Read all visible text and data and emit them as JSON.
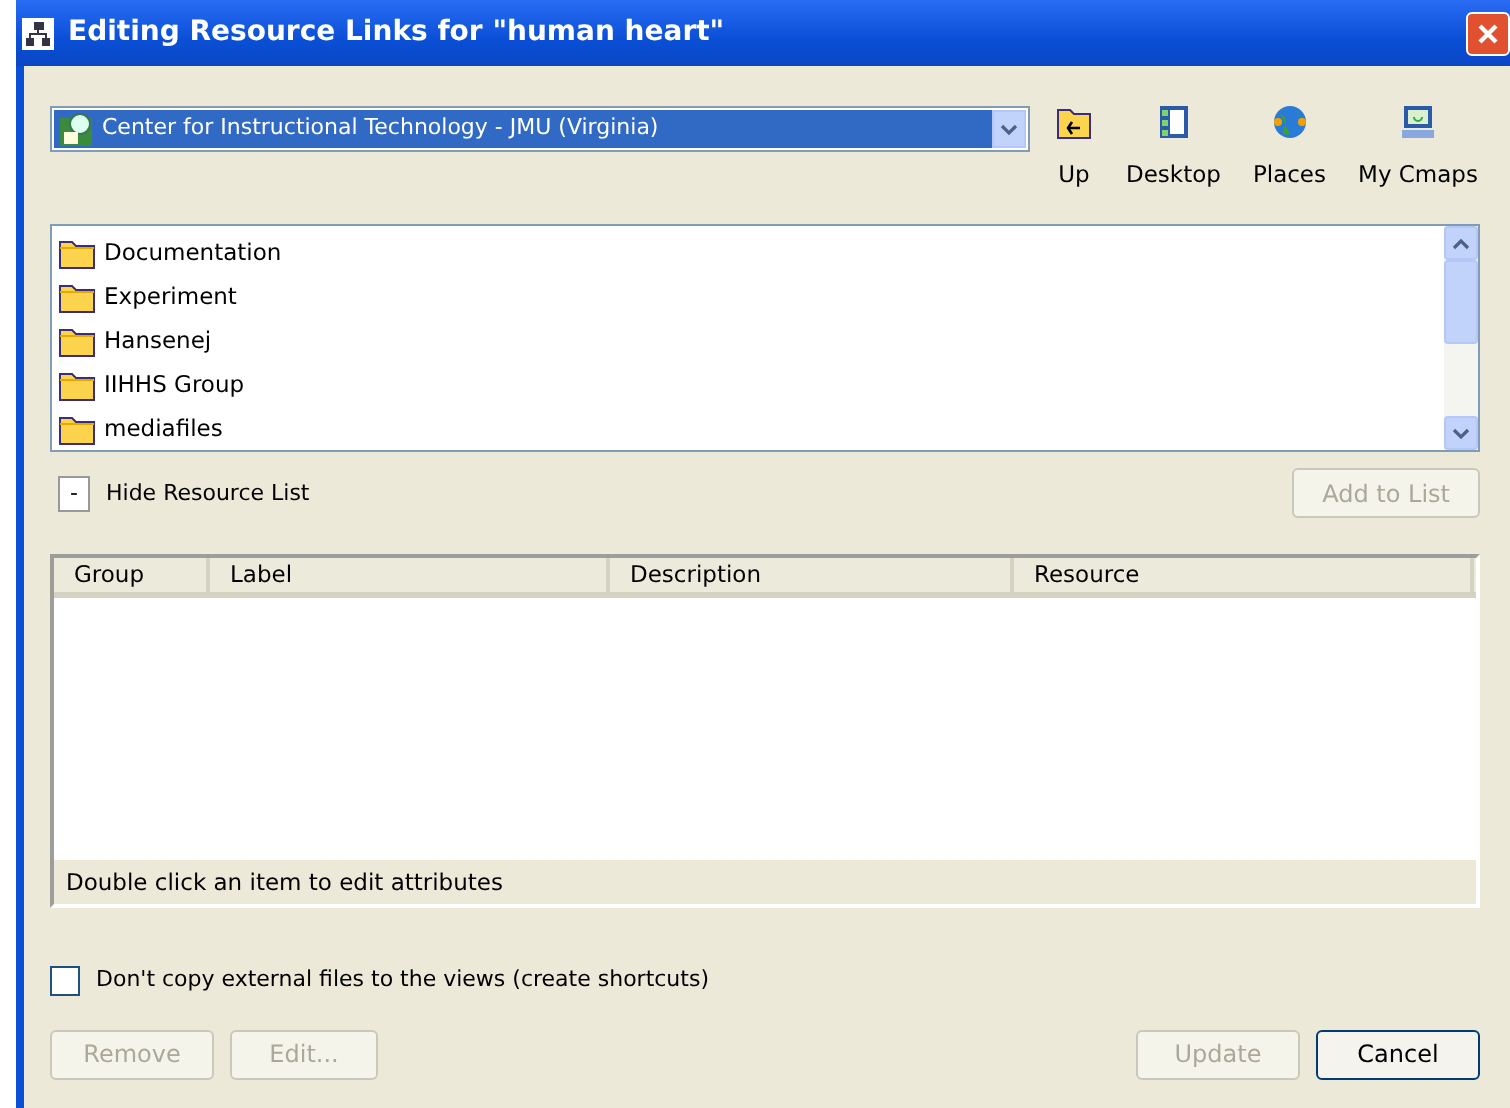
{
  "window": {
    "title": "Editing Resource Links for \"human heart\""
  },
  "location": {
    "value": "Center for Instructional Technology - JMU (Virginia)"
  },
  "nav_buttons": [
    {
      "label": "Up",
      "kind": "up"
    },
    {
      "label": "Desktop",
      "kind": "desktop"
    },
    {
      "label": "Places",
      "kind": "places"
    },
    {
      "label": "My Cmaps",
      "kind": "cmaps"
    }
  ],
  "resources": [
    {
      "name": "Documentation"
    },
    {
      "name": "Experiment"
    },
    {
      "name": "Hansenej"
    },
    {
      "name": "IIHHS Group"
    },
    {
      "name": "mediafiles"
    }
  ],
  "toggle": {
    "symbol": "-",
    "label": "Hide Resource List"
  },
  "add_button": {
    "label": "Add to List",
    "disabled": true
  },
  "table": {
    "columns": [
      "Group",
      "Label",
      "Description",
      "Resource"
    ],
    "hint": "Double click an item to edit attributes"
  },
  "copy_option": {
    "label": "Don't copy external files to the views (create shortcuts)",
    "checked": false
  },
  "buttons": [
    {
      "label": "Remove",
      "disabled": true
    },
    {
      "label": "Edit...",
      "disabled": true
    },
    {
      "label": "Update",
      "disabled": true
    },
    {
      "label": "Cancel",
      "disabled": false
    }
  ]
}
